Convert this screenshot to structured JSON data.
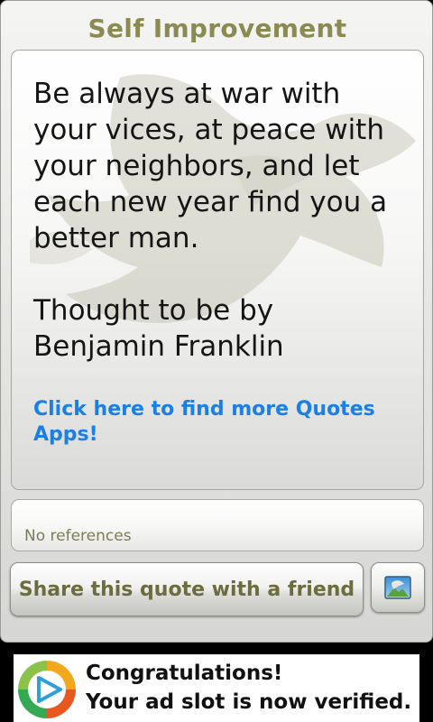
{
  "app": {
    "title": "Self Improvement"
  },
  "quote": {
    "text": "Be always at war with your vices, at peace with your neighbors, and let each new year find you a better man.",
    "author_line": "Thought to be by Benjamin Franklin",
    "more_apps_link": "Click here to find more Quotes Apps!"
  },
  "references": {
    "text": "No references"
  },
  "actions": {
    "share_label": "Share this quote with a friend",
    "icon": "image-icon"
  },
  "ad": {
    "line1": "Congratulations!",
    "line2": "Your ad slot is now verified.",
    "logo_icon": "play-logo-icon"
  },
  "colors": {
    "title": "#8a8a52",
    "link": "#1a7fe6",
    "button_text": "#6c6c3e",
    "references_text": "#7d7d56"
  }
}
